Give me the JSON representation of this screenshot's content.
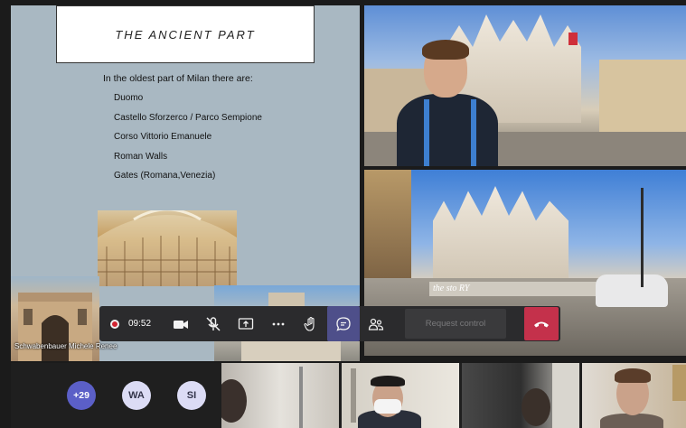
{
  "slide": {
    "title": "THE ANCIENT PART",
    "intro": "In the oldest part of Milan there are:",
    "items": [
      "Duomo",
      "Castello Sforzerco / Parco Sempione",
      "Corso Vittorio Emanuele",
      "Roman Walls",
      "Gates (Romana,Venezia)"
    ]
  },
  "presenter": {
    "name": "Schwabenbauer Michele Renee"
  },
  "tiles": {
    "sign_text": "the sto RY"
  },
  "toolbar": {
    "timer": "09:52",
    "request_control": "Request control",
    "icons": {
      "record": "record-icon",
      "camera": "camera-icon",
      "mic": "mic-muted-icon",
      "share": "share-screen-icon",
      "more": "more-icon",
      "hand": "raise-hand-icon",
      "chat": "chat-icon",
      "participants": "participants-icon",
      "hangup": "hang-up-icon"
    },
    "colors": {
      "chat_active": "#4e4f8a",
      "hangup": "#c4314b",
      "record": "#d12431"
    }
  },
  "participants": {
    "overflow_count": "+29",
    "initials": [
      "WA",
      "SI"
    ]
  }
}
